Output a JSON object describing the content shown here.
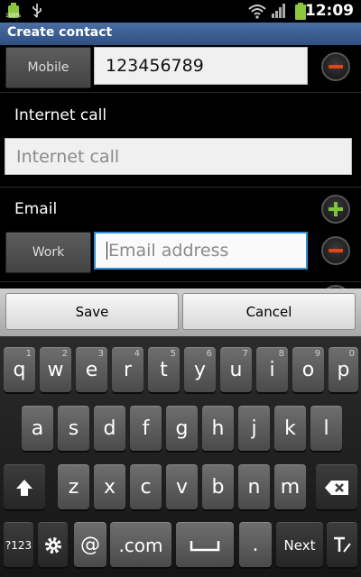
{
  "status": {
    "time": "12:09",
    "battery_badge": "100%"
  },
  "title": "Create contact",
  "form": {
    "mobile": {
      "type_label": "Mobile",
      "value": "123456789"
    },
    "internet_call": {
      "section_label": "Internet call",
      "placeholder": "Internet call"
    },
    "email": {
      "section_label": "Email",
      "type_label": "Work",
      "placeholder": "Email address"
    }
  },
  "actions": {
    "save": "Save",
    "cancel": "Cancel"
  },
  "keyboard": {
    "row1": [
      {
        "k": "q",
        "h": "1"
      },
      {
        "k": "w",
        "h": "2"
      },
      {
        "k": "e",
        "h": "3"
      },
      {
        "k": "r",
        "h": "4"
      },
      {
        "k": "t",
        "h": "5"
      },
      {
        "k": "y",
        "h": "6"
      },
      {
        "k": "u",
        "h": "7"
      },
      {
        "k": "i",
        "h": "8"
      },
      {
        "k": "o",
        "h": "9"
      },
      {
        "k": "p",
        "h": "0"
      }
    ],
    "row2": [
      "a",
      "s",
      "d",
      "f",
      "g",
      "h",
      "j",
      "k",
      "l"
    ],
    "row3": [
      "z",
      "x",
      "c",
      "v",
      "b",
      "n",
      "m"
    ],
    "symbols": "?123",
    "at": "@",
    "dotcom": ".com",
    "period": ".",
    "next": "Next"
  },
  "colors": {
    "accent": "#2f8fd6",
    "title_bar": "#3b5e93",
    "remove": "#e0451b",
    "add": "#7fc23b"
  }
}
